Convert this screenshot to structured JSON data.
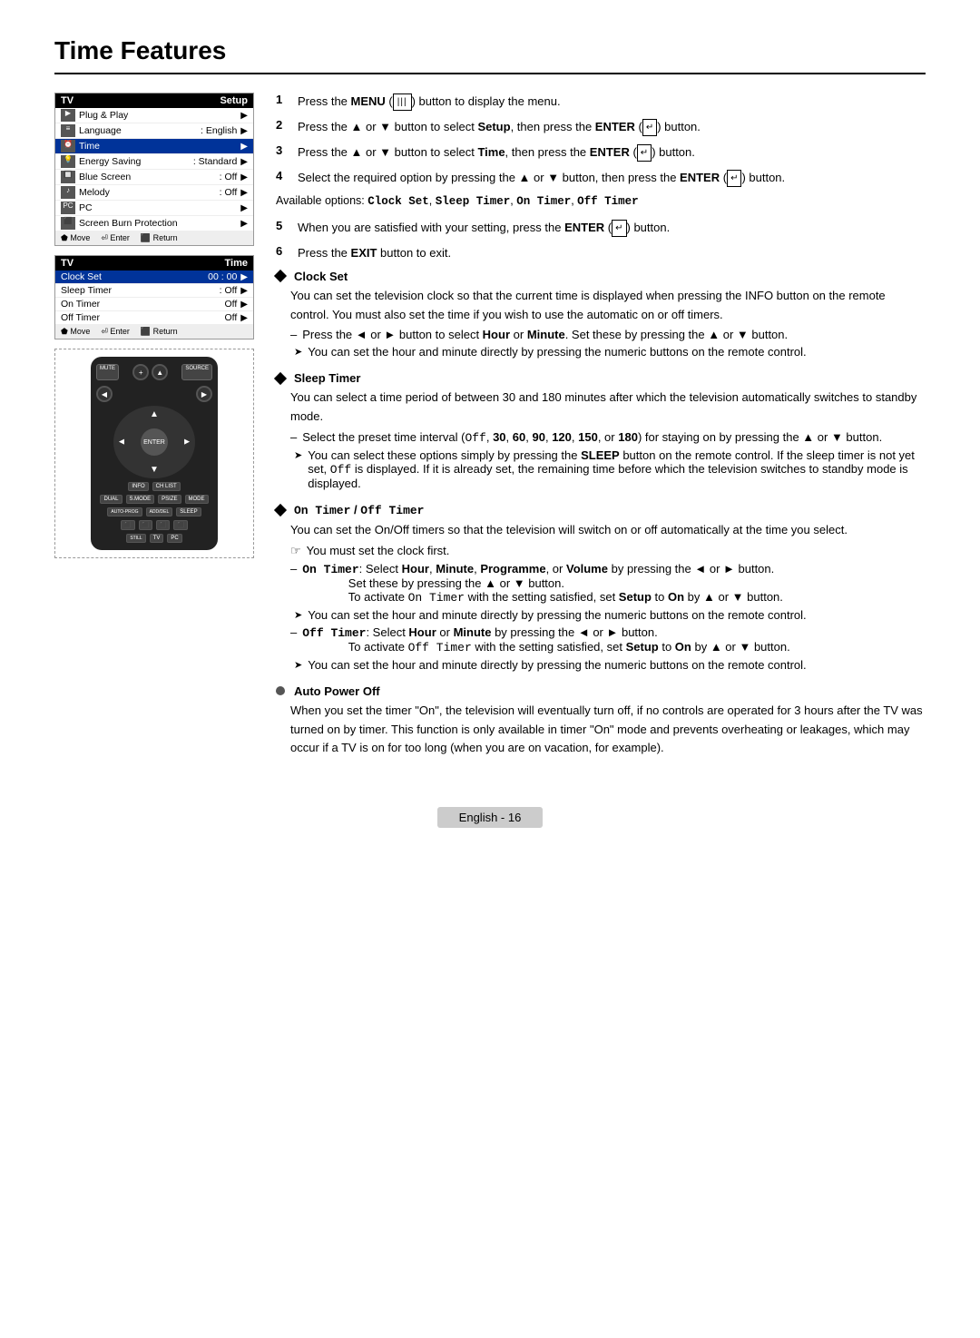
{
  "page": {
    "title": "Time Features"
  },
  "tv_menu_setup": {
    "header_left": "TV",
    "header_right": "Setup",
    "items": [
      {
        "icon": "▶",
        "label": "Plug & Play",
        "value": "",
        "arrow": "▶",
        "highlighted": false
      },
      {
        "icon": "≡",
        "label": "Language",
        "value": ": English",
        "arrow": "▶",
        "highlighted": false
      },
      {
        "icon": "▲",
        "label": "Time",
        "value": "",
        "arrow": "▶",
        "highlighted": true
      },
      {
        "icon": "♪",
        "label": "Energy Saving",
        "value": ": Standard",
        "arrow": "▶",
        "highlighted": false
      },
      {
        "icon": "♪",
        "label": "Blue Screen",
        "value": ": Off",
        "arrow": "▶",
        "highlighted": false
      },
      {
        "icon": "♪",
        "label": "Melody",
        "value": ": Off",
        "arrow": "▶",
        "highlighted": false
      },
      {
        "icon": "♪",
        "label": "PC",
        "value": "",
        "arrow": "▶",
        "highlighted": false
      },
      {
        "icon": "⬛",
        "label": "Screen Burn Protection",
        "value": "",
        "arrow": "▶",
        "highlighted": false
      }
    ],
    "footer": [
      "⬟ Move",
      "⏎ Enter",
      "⬛ Return"
    ]
  },
  "tv_menu_time": {
    "header_left": "TV",
    "header_right": "Time",
    "items": [
      {
        "label": "Clock Set",
        "value": "00 : 00",
        "arrow": "▶",
        "highlighted": true
      },
      {
        "label": "Sleep Timer",
        "value": ": Off",
        "arrow": "▶",
        "highlighted": false
      },
      {
        "label": "On Timer",
        "value": "Off",
        "arrow": "▶",
        "highlighted": false
      },
      {
        "label": "Off Timer",
        "value": "Off",
        "arrow": "▶",
        "highlighted": false
      }
    ],
    "footer": [
      "⬟ Move",
      "⏎ Enter",
      "⬛ Return"
    ]
  },
  "steps": [
    {
      "num": "1",
      "text": "Press the MENU (   ) button to display the menu."
    },
    {
      "num": "2",
      "text": "Press the ▲ or ▼ button to select Setup, then press the ENTER (  ) button."
    },
    {
      "num": "3",
      "text": "Press the ▲ or ▼ button to select Time, then press the ENTER (  ) button."
    },
    {
      "num": "4",
      "text": "Select the required option by pressing the ▲ or ▼ button, then press the ENTER (  ) button."
    },
    {
      "num": "5",
      "text": "When you are satisfied with your setting, press the ENTER (  ) button."
    },
    {
      "num": "6",
      "text": "Press the EXIT button to exit."
    }
  ],
  "available_options_label": "Available options:",
  "available_options": "Clock Set, Sleep Timer, On Timer, Off Timer",
  "sections": {
    "clock_set": {
      "title": "Clock Set",
      "body": "You can set the television clock so that the current time is displayed when pressing the INFO button on the remote control. You must also set the time if you wish to use the automatic on or off timers.",
      "sub_items": [
        "Press the ◄ or ► button to select Hour or Minute. Set these by pressing the ▲ or ▼ button."
      ],
      "arrow_items": [
        "You can set the hour and minute directly by pressing the numeric buttons on the remote control."
      ]
    },
    "sleep_timer": {
      "title": "Sleep Timer",
      "body": "You can select a time period of between 30 and 180 minutes after which the television automatically switches to standby mode.",
      "sub_items": [
        "Select the preset time interval (Off, 30, 60, 90, 120, 150, or 180) for staying on by pressing the ▲ or ▼ button."
      ],
      "arrow_items": [
        "You can select these options simply by pressing the SLEEP button on the remote control. If the sleep timer is not yet set, Off is displayed. If it is already set, the remaining time before which the television switches to standby mode is displayed."
      ]
    },
    "on_off_timer": {
      "title": "On Timer / Off Timer",
      "body": "You can set the On/Off timers so that the television will switch on or off automatically at the time you select.",
      "note": "You must set the clock first.",
      "on_timer_label": "On Timer:",
      "on_timer_text1": "Select Hour, Minute, Programme, or Volume by pressing the ◄ or ► button.",
      "on_timer_text2": "Set these by pressing the ▲ or ▼ button.",
      "on_timer_text3": "To activate On Timer with the setting satisfied, set Setup to On by ▲ or ▼ button.",
      "on_timer_arrow": "You can set the hour and minute directly by pressing the numeric buttons on the remote control.",
      "off_timer_label": "Off Timer:",
      "off_timer_text1": "Select Hour or Minute by pressing the ◄ or ► button.",
      "off_timer_text2": "To activate Off Timer with the setting satisfied, set Setup to On by ▲ or ▼ button.",
      "off_timer_arrow": "You can set the hour and minute directly by pressing the numeric buttons on the remote control."
    },
    "auto_power": {
      "title": "Auto Power Off",
      "body": "When you set the timer \"On\", the television will eventually turn off, if no controls are operated for 3 hours after the TV was turned on by timer. This function is only available in timer \"On\" mode and prevents overheating or leakages, which may occur if a TV is on for too long (when you are on vacation, for example)."
    }
  },
  "footer": {
    "text": "English - 16"
  }
}
